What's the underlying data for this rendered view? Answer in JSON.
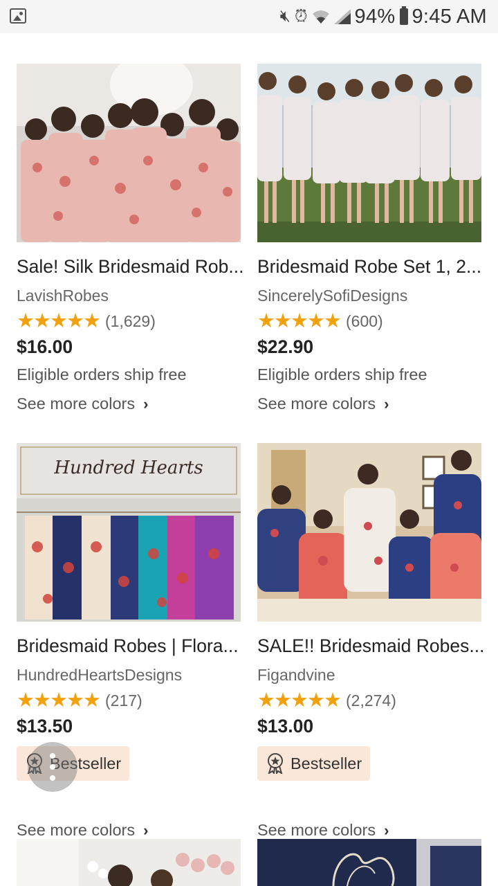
{
  "status_bar": {
    "battery": "94%",
    "time": "9:45 AM",
    "icons": [
      "gallery-icon",
      "mute-icon",
      "alarm-icon",
      "wifi-icon",
      "signal-icon",
      "battery-icon"
    ]
  },
  "colors": {
    "star": "#f1a10d",
    "badge_bg": "#fbe7d9"
  },
  "listings": [
    {
      "title": "Sale! Silk Bridesmaid Rob...",
      "shop": "LavishRobes",
      "stars": "★★★★★",
      "reviews": "(1,629)",
      "price": "$16.00",
      "shipping": "Eligible orders ship free",
      "see_more": "See more colors"
    },
    {
      "title": "Bridesmaid Robe Set 1, 2...",
      "shop": "SincerelySofiDesigns",
      "stars": "★★★★★",
      "reviews": "(600)",
      "price": "$22.90",
      "shipping": "Eligible orders ship free",
      "see_more": "See more colors"
    },
    {
      "title": "Bridesmaid Robes | Flora...",
      "shop": "HundredHeartsDesigns",
      "stars": "★★★★★",
      "reviews": "(217)",
      "price": "$13.50",
      "badge": "Bestseller",
      "see_more": "See more colors",
      "image_text": "Hundred Hearts"
    },
    {
      "title": "SALE!! Bridesmaid Robes...",
      "shop": "Figandvine",
      "stars": "★★★★★",
      "reviews": "(2,274)",
      "price": "$13.00",
      "badge": "Bestseller",
      "see_more": "See more colors"
    }
  ]
}
